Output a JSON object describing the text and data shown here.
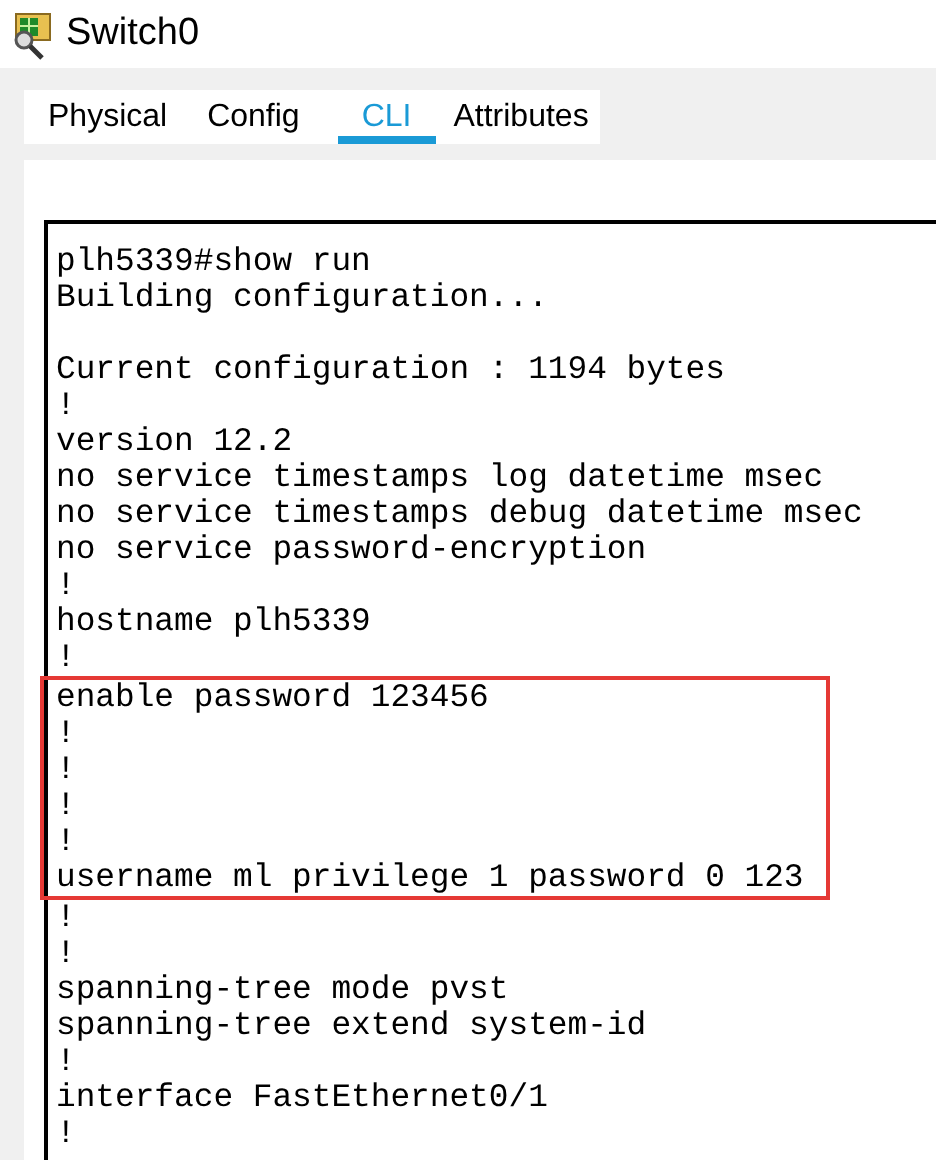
{
  "window": {
    "title": "Switch0"
  },
  "tabs": [
    {
      "label": "Physical",
      "selected": false
    },
    {
      "label": "Config",
      "selected": false
    },
    {
      "label": "CLI",
      "selected": true
    },
    {
      "label": "Attributes",
      "selected": false
    }
  ],
  "cli": {
    "lines": [
      {
        "kind": "text",
        "text": "plh5339#show run",
        "highlighted": false
      },
      {
        "kind": "text",
        "text": "Building configuration...",
        "highlighted": false
      },
      {
        "kind": "blank",
        "highlighted": false
      },
      {
        "kind": "text",
        "text": "Current configuration : 1194 bytes",
        "highlighted": false
      },
      {
        "kind": "text",
        "text": "!",
        "highlighted": false
      },
      {
        "kind": "text",
        "text": "version 12.2",
        "highlighted": false
      },
      {
        "kind": "text",
        "text": "no service timestamps log datetime msec",
        "highlighted": false
      },
      {
        "kind": "text",
        "text": "no service timestamps debug datetime msec",
        "highlighted": false
      },
      {
        "kind": "text",
        "text": "no service password-encryption",
        "highlighted": false
      },
      {
        "kind": "text",
        "text": "!",
        "highlighted": false
      },
      {
        "kind": "text",
        "text": "hostname plh5339",
        "highlighted": false
      },
      {
        "kind": "text",
        "text": "!",
        "highlighted": false
      },
      {
        "kind": "text",
        "text": "enable password 123456",
        "highlighted": true
      },
      {
        "kind": "text",
        "text": "!",
        "highlighted": true
      },
      {
        "kind": "text",
        "text": "!",
        "highlighted": true
      },
      {
        "kind": "text",
        "text": "!",
        "highlighted": true
      },
      {
        "kind": "text",
        "text": "!",
        "highlighted": true
      },
      {
        "kind": "text",
        "text": "username ml privilege 1 password 0 123",
        "highlighted": true
      },
      {
        "kind": "text",
        "text": "!",
        "highlighted": false
      },
      {
        "kind": "text",
        "text": "!",
        "highlighted": false
      },
      {
        "kind": "text",
        "text": "spanning-tree mode pvst",
        "highlighted": false
      },
      {
        "kind": "text",
        "text": "spanning-tree extend system-id",
        "highlighted": false
      },
      {
        "kind": "text",
        "text": "!",
        "highlighted": false
      },
      {
        "kind": "text",
        "text": "interface FastEthernet0/1",
        "highlighted": false
      },
      {
        "kind": "text",
        "text": "!",
        "highlighted": false
      }
    ]
  }
}
